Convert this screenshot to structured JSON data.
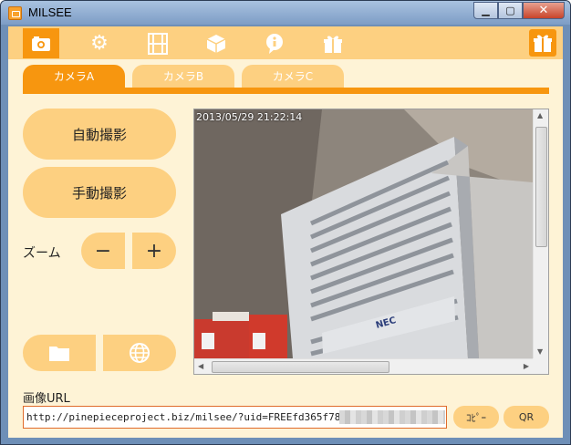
{
  "window": {
    "title": "MILSEE",
    "controls": [
      "minimize",
      "maximize",
      "close"
    ]
  },
  "toolbar": {
    "icons": [
      "camera-icon",
      "gear-icon",
      "film-icon",
      "box-icon",
      "info-icon",
      "gift-icon"
    ],
    "active_index": 0,
    "right_icon": "present-icon"
  },
  "camera_tabs": [
    {
      "label": "カメラA",
      "active": true
    },
    {
      "label": "カメラB",
      "active": false
    },
    {
      "label": "カメラC",
      "active": false
    }
  ],
  "controls": {
    "auto_capture": "自動撮影",
    "manual_capture": "手動撮影",
    "zoom_label": "ズーム",
    "zoom_minus": "−",
    "zoom_plus": "+"
  },
  "viewer": {
    "timestamp": "2013/05/29 21:22:14",
    "server_brand": "NEC"
  },
  "url": {
    "label": "画像URL",
    "value": "http://pinepieceproject.biz/milsee/?uid=FREEfd365f7872bc",
    "copy_button": "ｺﾋﾟｰ",
    "qr_button": "QR"
  },
  "colors": {
    "accent": "#f7960f",
    "light_accent": "#fdd081",
    "background": "#fef3d6"
  }
}
